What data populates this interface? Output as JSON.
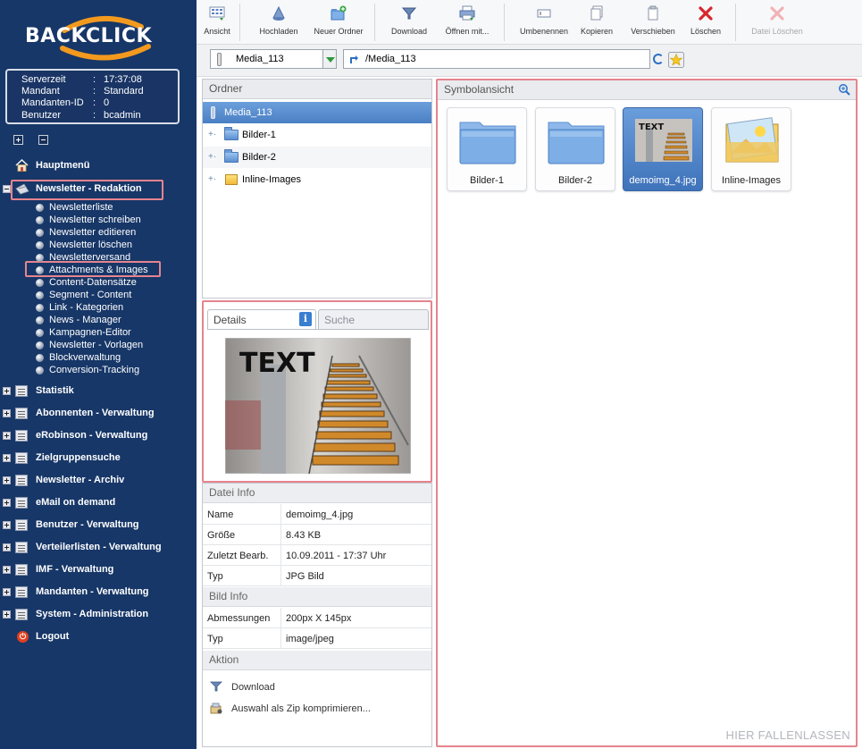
{
  "logo": {
    "text": "BACKCLICK"
  },
  "server_info": [
    {
      "key": "Serverzeit",
      "value": "17:37:08"
    },
    {
      "key": "Mandant",
      "value": "Standard"
    },
    {
      "key": "Mandanten-ID",
      "value": "0"
    },
    {
      "key": "Benutzer",
      "value": "bcadmin"
    }
  ],
  "info_sep": ":",
  "menu": {
    "home": "Hauptmenü",
    "newsletter_redaktion": "Newsletter - Redaktion",
    "sub_items": [
      "Newsletterliste",
      "Newsletter schreiben",
      "Newsletter editieren",
      "Newsletter löschen",
      "Newsletterversand",
      "Attachments & Images",
      "Content-Datensätze",
      "Segment - Content",
      "Link - Kategorien",
      "News - Manager",
      "Kampagnen-Editor",
      "Newsletter - Vorlagen",
      "Blockverwaltung",
      "Conversion-Tracking"
    ],
    "sections": [
      "Statistik",
      "Abonnenten - Verwaltung",
      "eRobinson - Verwaltung",
      "Zielgruppensuche",
      "Newsletter - Archiv",
      "eMail on demand",
      "Benutzer - Verwaltung",
      "Verteilerlisten - Verwaltung",
      "IMF - Verwaltung",
      "Mandanten - Verwaltung",
      "System - Administration"
    ],
    "logout": "Logout"
  },
  "toolbar": {
    "ansicht": "Ansicht",
    "hochladen": "Hochladen",
    "neuer_ordner": "Neuer Ordner",
    "download": "Download",
    "oeffnen_mit": "Öffnen mit...",
    "umbenennen": "Umbenennen",
    "kopieren": "Kopieren",
    "verschieben": "Verschieben",
    "loeschen": "Löschen",
    "datei_loeschen": "Datei Löschen"
  },
  "pathbar": {
    "combo_value": "Media_113",
    "path_value": "/Media_113"
  },
  "ordner": {
    "title": "Ordner",
    "root": "Media_113",
    "children": [
      "Bilder-1",
      "Bilder-2",
      "Inline-Images"
    ]
  },
  "details": {
    "tab_details": "Details",
    "tab_suche": "Suche",
    "info_icon": "i",
    "preview_text": "TEXT"
  },
  "datei_info": {
    "title": "Datei Info",
    "rows": [
      {
        "key": "Name",
        "value": "demoimg_4.jpg"
      },
      {
        "key": "Größe",
        "value": "8.43 KB"
      },
      {
        "key": "Zuletzt Bearb.",
        "value": "10.09.2011 - 17:37 Uhr"
      },
      {
        "key": "Typ",
        "value": "JPG Bild"
      }
    ]
  },
  "bild_info": {
    "title": "Bild Info",
    "rows": [
      {
        "key": "Abmessungen",
        "value": "200px X 145px"
      },
      {
        "key": "Typ",
        "value": "image/jpeg"
      }
    ]
  },
  "aktion": {
    "title": "Aktion",
    "download": "Download",
    "zip": "Auswahl als Zip komprimieren..."
  },
  "symbol": {
    "title": "Symbolansicht",
    "tiles": [
      "Bilder-1",
      "Bilder-2",
      "demoimg_4.jpg",
      "Inline-Images"
    ],
    "thumb_text": "TEXT",
    "drop_hint": "HIER FALLENLASSEN"
  },
  "colors": {
    "sidebar_bg": "#173768",
    "highlight_border": "#e5848e",
    "selection_blue": "#4a7fc4"
  }
}
